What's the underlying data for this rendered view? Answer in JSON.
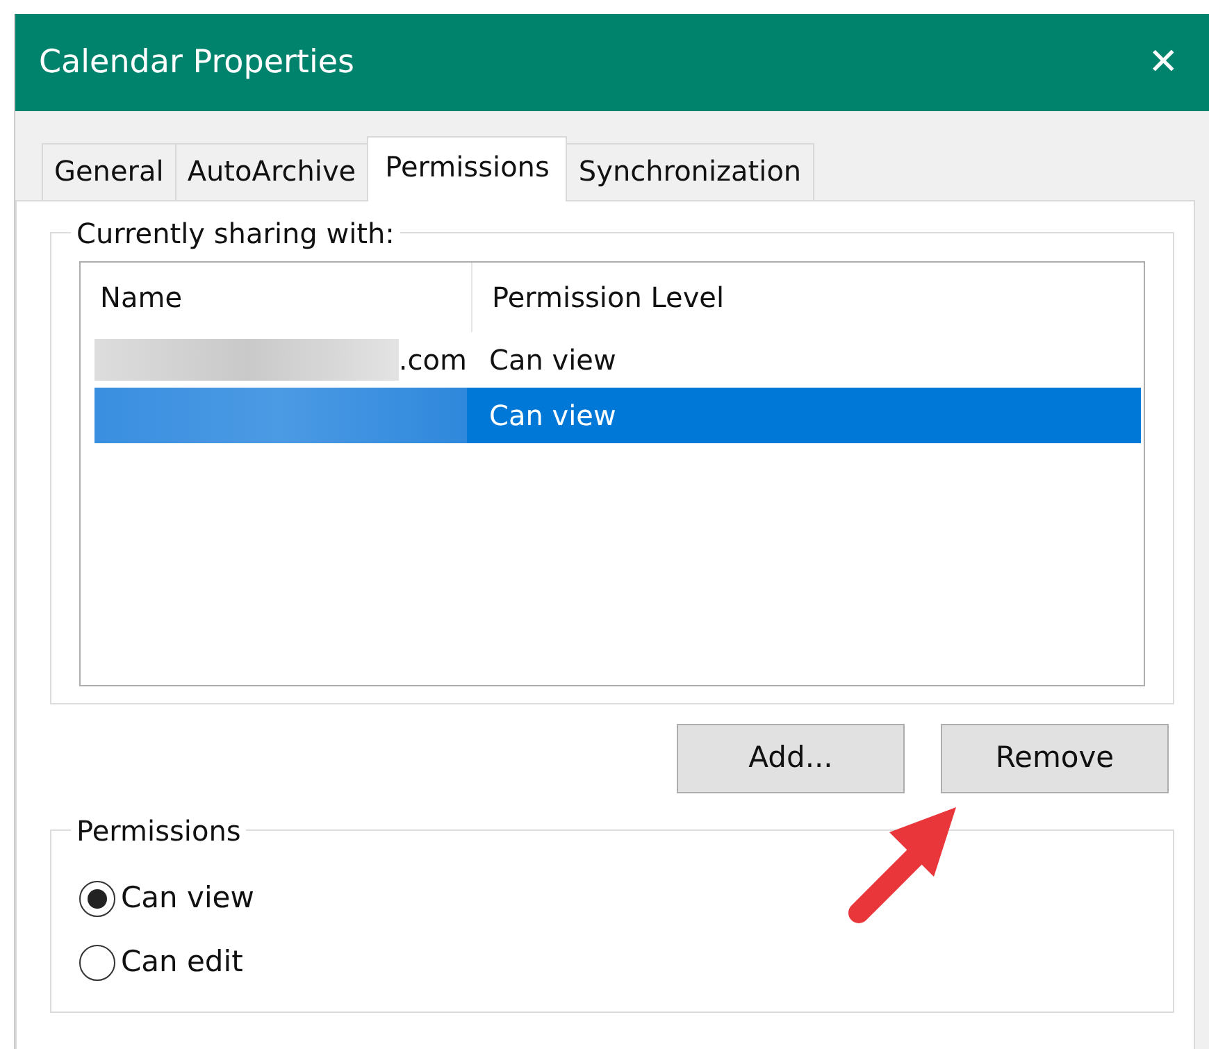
{
  "window": {
    "title": "Calendar Properties",
    "close": "✕"
  },
  "tabs": [
    {
      "label": "General",
      "selected": false
    },
    {
      "label": "AutoArchive",
      "selected": false
    },
    {
      "label": "Permissions",
      "selected": true
    },
    {
      "label": "Synchronization",
      "selected": false
    }
  ],
  "sharing": {
    "legend": "Currently sharing with:",
    "columns": [
      "Name",
      "Permission Level"
    ],
    "rows": [
      {
        "name": ".com",
        "level": "Can view",
        "selected": false
      },
      {
        "level": "Can view",
        "selected": true
      }
    ]
  },
  "buttons": [
    "Add...",
    "Remove"
  ],
  "permissions": {
    "legend": "Permissions",
    "options": [
      {
        "label": "Can view",
        "selected": true
      },
      {
        "label": "Can edit",
        "selected": false
      }
    ]
  }
}
